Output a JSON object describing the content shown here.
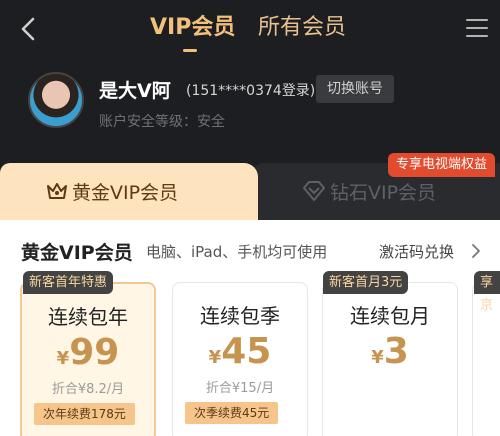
{
  "nav": {
    "tabs": [
      "VIP会员",
      "所有会员"
    ]
  },
  "user": {
    "name": "是大V阿",
    "login_info": "(151****0374登录)",
    "switch_button": "切换账号",
    "security": "账户安全等级：安全"
  },
  "tier_tabs": {
    "tv_badge": "专享电视端权益",
    "gold": "黄金VIP会员",
    "diamond": "钻石VIP会员"
  },
  "section": {
    "title": "黄金VIP会员",
    "subtitle": "电脑、iPad、手机均可使用",
    "activation": "激活码兑换"
  },
  "plans": [
    {
      "ribbon": "新客首年特惠",
      "title": "连续包年",
      "currency": "¥",
      "price": "99",
      "discount": "折合¥8.2/月",
      "renew": "次年续费178元",
      "selected": true
    },
    {
      "ribbon": "",
      "title": "连续包季",
      "currency": "¥",
      "price": "45",
      "discount": "折合¥15/月",
      "renew": "次季续费45元",
      "selected": false
    },
    {
      "ribbon": "新客首月3元",
      "title": "连续包月",
      "currency": "¥",
      "price": "3",
      "discount": "",
      "renew": "",
      "selected": false
    },
    {
      "ribbon": "享京",
      "title": "",
      "currency": "",
      "price": "",
      "discount": "",
      "renew": "",
      "selected": false
    }
  ],
  "colors": {
    "accent_gold": "#f3c07a",
    "price": "#c79450",
    "tv_badge": "#e24b2d"
  }
}
